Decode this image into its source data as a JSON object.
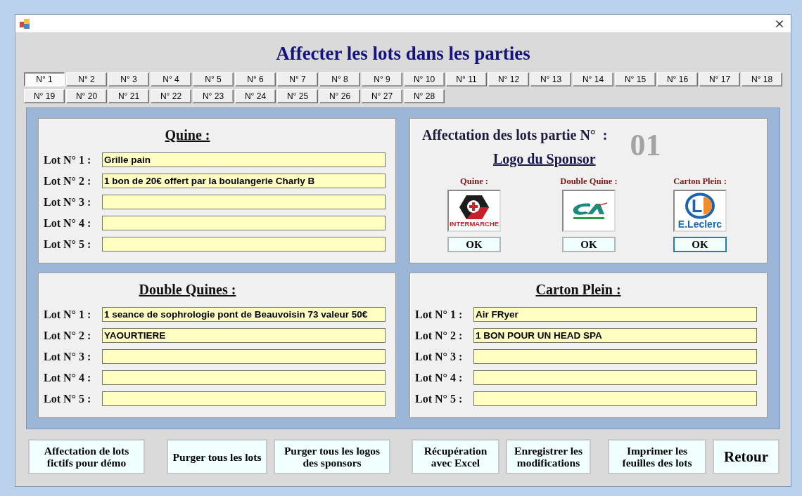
{
  "heading": "Affecter les lots dans les parties",
  "tabs": [
    {
      "label": "N° 1",
      "selected": true
    },
    {
      "label": "N° 2",
      "selected": false
    },
    {
      "label": "N° 3",
      "selected": false
    },
    {
      "label": "N° 4",
      "selected": false
    },
    {
      "label": "N° 5",
      "selected": false
    },
    {
      "label": "N° 6",
      "selected": false
    },
    {
      "label": "N° 7",
      "selected": false
    },
    {
      "label": "N° 8",
      "selected": false
    },
    {
      "label": "N° 9",
      "selected": false
    },
    {
      "label": "N° 10",
      "selected": false
    },
    {
      "label": "N° 11",
      "selected": false
    },
    {
      "label": "N° 12",
      "selected": false
    },
    {
      "label": "N° 13",
      "selected": false
    },
    {
      "label": "N° 14",
      "selected": false
    },
    {
      "label": "N° 15",
      "selected": false
    },
    {
      "label": "N° 16",
      "selected": false
    },
    {
      "label": "N° 17",
      "selected": false
    },
    {
      "label": "N° 18",
      "selected": false
    },
    {
      "label": "N° 19",
      "selected": false
    },
    {
      "label": "N° 20",
      "selected": false
    },
    {
      "label": "N° 21",
      "selected": false
    },
    {
      "label": "N° 22",
      "selected": false
    },
    {
      "label": "N° 23",
      "selected": false
    },
    {
      "label": "N° 24",
      "selected": false
    },
    {
      "label": "N° 25",
      "selected": false
    },
    {
      "label": "N° 26",
      "selected": false
    },
    {
      "label": "N° 27",
      "selected": false
    },
    {
      "label": "N° 28",
      "selected": false
    }
  ],
  "panels": [
    {
      "kind": "prizes",
      "title": "Quine :",
      "lots": [
        {
          "label": "Lot N° 1 :",
          "value": "Grille pain"
        },
        {
          "label": "Lot N° 2 :",
          "value": "1 bon de 20€ offert par la boulangerie Charly B"
        },
        {
          "label": "Lot N° 3 :"
        },
        {
          "label": "Lot N° 4 :"
        },
        {
          "label": "Lot N° 5 :"
        }
      ]
    },
    {
      "kind": "sponsors",
      "heading": "Affectation des lots partie N°  :",
      "game_number": "01",
      "subtitle": "Logo du Sponsor",
      "sponsors": [
        {
          "label": "Quine :",
          "logo": {
            "kind": "hexagon",
            "text": "INTERMARCHE"
          },
          "button": "OK",
          "focused": false
        },
        {
          "label": "Double Quine :",
          "logo": {
            "kind": "swoosh"
          },
          "button": "OK",
          "focused": false
        },
        {
          "label": "Carton Plein :",
          "logo": {
            "kind": "ring",
            "letter": "L",
            "text": "E.Leclerc"
          },
          "button": "OK",
          "focused": true
        }
      ]
    },
    {
      "kind": "prizes",
      "title": "Double Quines :",
      "lots": [
        {
          "label": "Lot N° 1 :",
          "value": "1 seance de sophrologie pont de Beauvoisin 73 valeur 50€"
        },
        {
          "label": "Lot N° 2 :",
          "value": "YAOURTIERE"
        },
        {
          "label": "Lot N° 3 :"
        },
        {
          "label": "Lot N° 4 :"
        },
        {
          "label": "Lot N° 5 :"
        }
      ]
    },
    {
      "kind": "prizes",
      "title": "Carton Plein :",
      "lots": [
        {
          "label": "Lot N° 1 :",
          "value": "Air FRyer"
        },
        {
          "label": "Lot N° 2 :",
          "value": "1 BON POUR UN HEAD SPA"
        },
        {
          "label": "Lot N° 3 :"
        },
        {
          "label": "Lot N° 4 :"
        },
        {
          "label": "Lot N° 5 :"
        }
      ]
    }
  ],
  "actions": [
    "Affectation de lots\nfictifs pour démo",
    "Purger tous les lots",
    "Purger tous les logos\ndes sponsors",
    "Récupération\navec Excel",
    "Enregistrer les\nmodifications",
    "Imprimer les\nfeuilles des lots",
    "Retour"
  ]
}
